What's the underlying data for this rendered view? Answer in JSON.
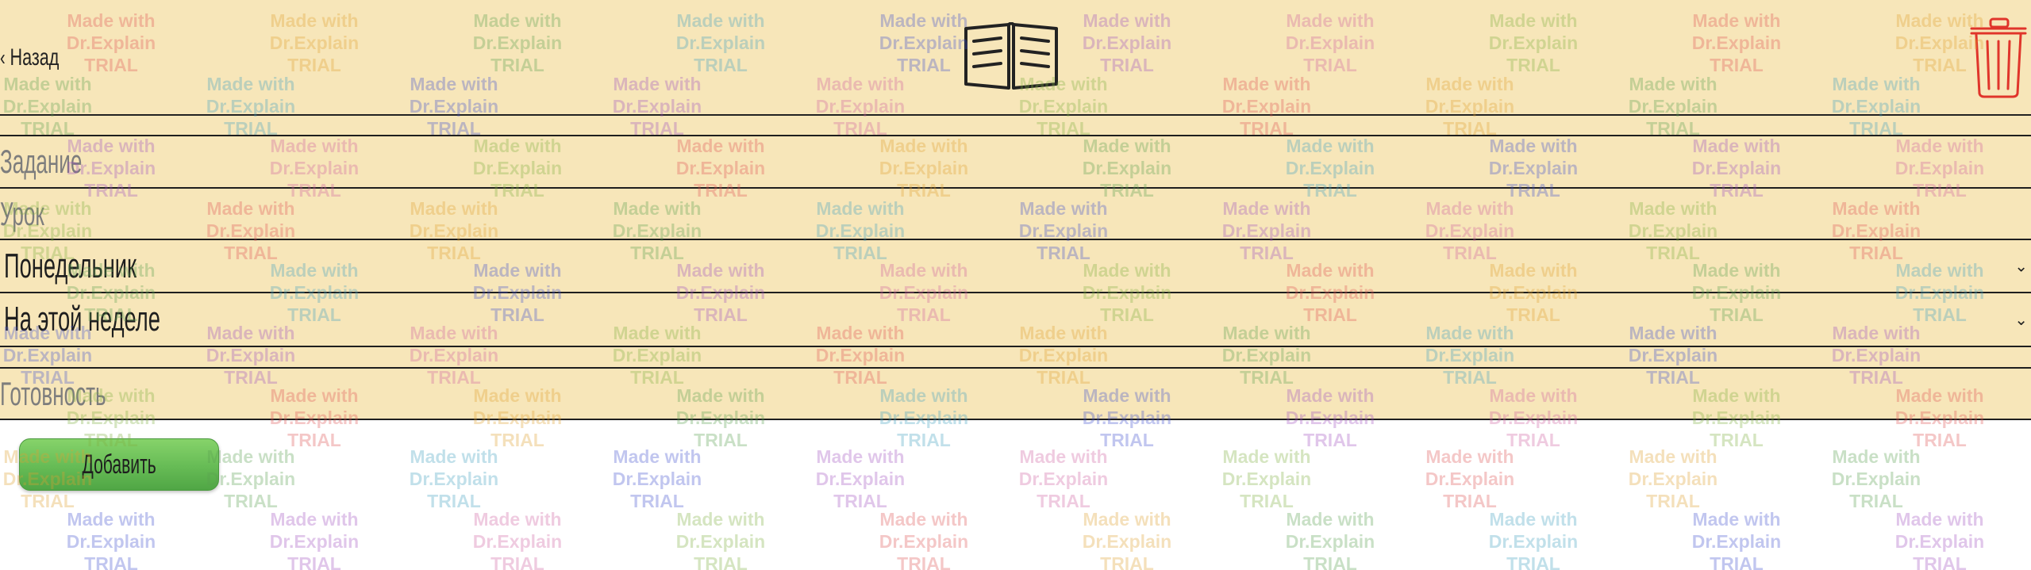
{
  "header": {
    "back_label": "Назад",
    "back_icon": "chevron-left-icon",
    "logo_icon": "open-book-icon",
    "delete_icon": "trash-icon"
  },
  "form": {
    "task_placeholder": "Задание",
    "lesson_placeholder": "Урок",
    "day_select": {
      "value": "Понедельник",
      "icon": "chevron-down-icon"
    },
    "week_select": {
      "value": "На этой неделе",
      "icon": "chevron-down-icon"
    },
    "readiness_placeholder": "Готовность"
  },
  "add_button_label": "Добавить",
  "colors": {
    "panel_background": "#f7e6b9",
    "button_green": "#66bb55",
    "trash_red": "#e0352b"
  },
  "watermark": {
    "line1": "Made with",
    "line2": "Dr.Explain",
    "line3": "TRIAL"
  }
}
